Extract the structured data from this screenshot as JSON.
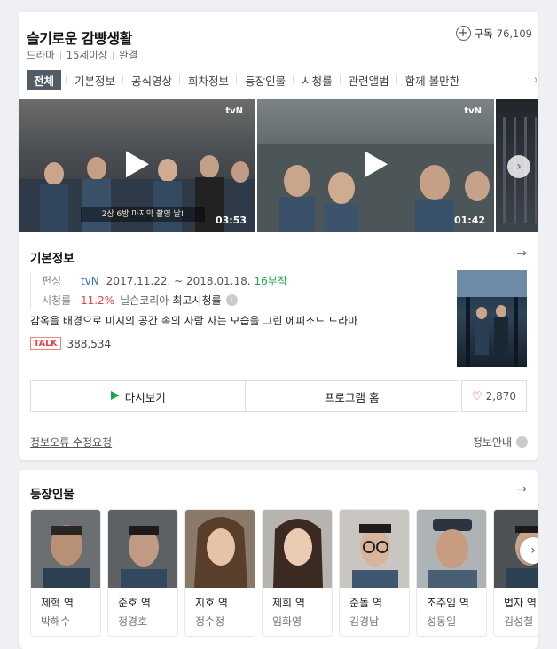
{
  "header": {
    "title": "슬기로운 감빵생활",
    "subscribe_label": "구독",
    "subscribe_count": "76,109",
    "meta": [
      "드라마",
      "15세이상",
      "완결"
    ]
  },
  "tabs": [
    "전체",
    "기본정보",
    "공식영상",
    "회차정보",
    "등장인물",
    "시청률",
    "관련앨범",
    "함께 볼만한"
  ],
  "videos": [
    {
      "duration": "03:53",
      "caption": "2상 6방 마지막 촬영 날!",
      "channel": "tvN"
    },
    {
      "duration": "01:42",
      "channel": "tvN"
    },
    {
      "duration": ""
    }
  ],
  "basic_info": {
    "title": "기본정보",
    "channel_label": "편성",
    "channel": "tvN",
    "dates": "2017.11.22. ~ 2018.01.18.",
    "episodes": "16부작",
    "rating_label": "시청률",
    "rating": "11.2%",
    "rating_source": "닐슨코리아",
    "rating_note": "최고시청률",
    "description": "감옥을 배경으로 미지의 공간 속의 사람 사는 모습을 그린 에피소드 드라마",
    "talk_badge": "TALK",
    "talk_count": "388,534",
    "rewatch_label": "다시보기",
    "program_home_label": "프로그램 홈",
    "like_count": "2,870",
    "report_label": "정보오류 수정요청",
    "guide_label": "정보안내"
  },
  "cast": {
    "title": "등장인물",
    "members": [
      {
        "role": "제혁 역",
        "actor": "박해수",
        "bg": "#6b6f72"
      },
      {
        "role": "준호 역",
        "actor": "정경호",
        "bg": "#5d6164"
      },
      {
        "role": "지호 역",
        "actor": "정수정",
        "bg": "#8a7a6a"
      },
      {
        "role": "제희 역",
        "actor": "임화영",
        "bg": "#b7b4b0"
      },
      {
        "role": "준돌 역",
        "actor": "김경남",
        "bg": "#c9c6c2"
      },
      {
        "role": "조주임 역",
        "actor": "성동일",
        "bg": "#aeb3b6"
      },
      {
        "role": "법자 역",
        "actor": "김성철",
        "bg": "#4d5256"
      }
    ]
  },
  "colors": {
    "accent_green": "#1aa74a",
    "rating_red": "#e8433e",
    "link_blue": "#2f6fc2",
    "tab_active": "#525c66"
  }
}
